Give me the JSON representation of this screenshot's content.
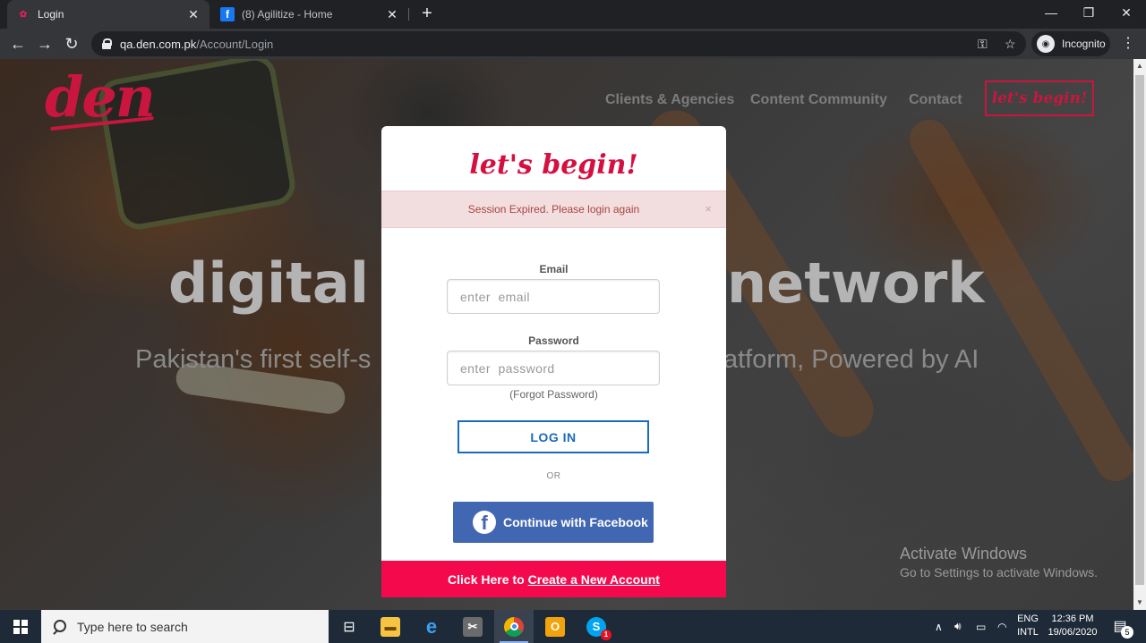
{
  "browser": {
    "tabs": [
      {
        "title": "Login",
        "favicon": "den-icon",
        "active": true
      },
      {
        "title": "(8) Agilitize - Home",
        "favicon": "facebook-icon",
        "active": false
      }
    ],
    "url_host": "qa.den.com.pk",
    "url_path": "/Account/Login",
    "profile_label": "Incognito"
  },
  "site": {
    "logo": "den",
    "nav": [
      "Clients & Agencies",
      "Content Community",
      "Contact"
    ],
    "cta": "let's begin!",
    "hero_title_left": "digital e",
    "hero_title_right": "network",
    "hero_sub_left": "Pakistan's first self-s",
    "hero_sub_right": "atform, Powered by AI"
  },
  "modal": {
    "logo_text": "let's begin!",
    "alert_text": "Session Expired. Please login again",
    "alert_close": "×",
    "email_label": "Email",
    "email_placeholder": "enter  email",
    "password_label": "Password",
    "password_placeholder": "enter  password",
    "forgot": "(Forgot Password)",
    "login_button": "LOG IN",
    "or": "OR",
    "facebook_button": "Continue with Facebook",
    "signup_prefix": "Click Here to",
    "signup_link": "Create a New Account"
  },
  "watermark": {
    "line1": "Activate Windows",
    "line2": "Go to Settings to activate Windows."
  },
  "taskbar": {
    "search_placeholder": "Type here to search",
    "lang_top": "ENG",
    "lang_bottom": "INTL",
    "time": "12:36 PM",
    "date": "19/06/2020",
    "notification_count": "5",
    "skype_badge": "1"
  },
  "colors": {
    "brand_pink": "#f5094d",
    "brand_red": "#c9163f",
    "facebook_blue": "#4267b2",
    "login_blue": "#1a6bbd",
    "alert_bg": "#f2dede",
    "alert_text": "#a94442"
  }
}
